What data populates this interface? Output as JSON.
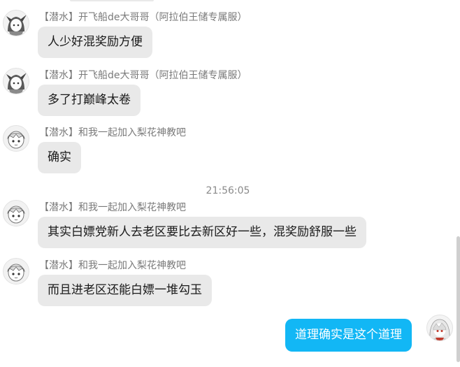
{
  "messages": [
    {
      "sender": "【潜水】开飞船de大哥哥（阿拉伯王储专属服）",
      "text": "人少好混奖励方便",
      "avatar_icon": "anime-character-avatar-icon"
    },
    {
      "sender": "【潜水】开飞船de大哥哥（阿拉伯王储专属服）",
      "text": "多了打巅峰太卷",
      "avatar_icon": "anime-character-avatar-icon"
    },
    {
      "sender": "【潜水】和我一起加入梨花神教吧",
      "text": "确实",
      "avatar_icon": "anime-girl-avatar-icon"
    },
    {
      "sender": "【潜水】和我一起加入梨花神教吧",
      "text": "其实白嫖党新人去老区要比去新区好一些，混奖励舒服一些",
      "avatar_icon": "anime-girl-avatar-icon"
    },
    {
      "sender": "【潜水】和我一起加入梨花神教吧",
      "text": "而且进老区还能白嫖一堆勾玉",
      "avatar_icon": "anime-girl-avatar-icon"
    }
  ],
  "timestamp": "21:56:05",
  "self_message": {
    "text": "道理确实是这个道理",
    "avatar_icon": "white-hair-girl-avatar-icon"
  },
  "colors": {
    "self_bubble": "#12b7f5",
    "other_bubble": "#e9e9e9",
    "sender_text": "#7a7a7a"
  }
}
